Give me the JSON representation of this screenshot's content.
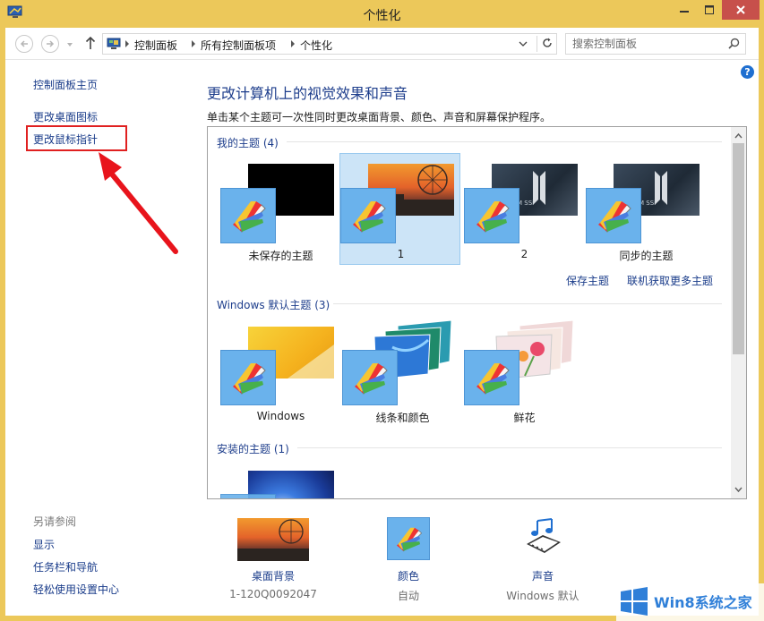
{
  "window": {
    "title": "个性化",
    "colors": {
      "frame": "#ecc85a",
      "close": "#c7504b",
      "link": "#1a3c8a",
      "heading": "#1e3e8c",
      "selection": "#cce4f7"
    }
  },
  "nav": {
    "breadcrumbs": [
      "控制面板",
      "所有控制面板项",
      "个性化"
    ],
    "search_placeholder": "搜索控制面板"
  },
  "left_pane": {
    "links": [
      "控制面板主页",
      "更改桌面图标",
      "更改鼠标指针"
    ],
    "see_also_title": "另请参阅",
    "see_also": [
      "显示",
      "任务栏和导航",
      "轻松使用设置中心"
    ]
  },
  "main": {
    "title": "更改计算机上的视觉效果和声音",
    "description": "单击某个主题可一次性同时更改桌面背景、颜色、声音和屏幕保护程序。"
  },
  "groups": {
    "my_themes": {
      "title": "我的主题 (4)",
      "themes": [
        {
          "label": "未保存的主题",
          "selected": false
        },
        {
          "label": "1",
          "selected": true
        },
        {
          "label": "2",
          "selected": false
        },
        {
          "label": "同步的主题",
          "selected": false
        }
      ],
      "save_link": "保存主题",
      "online_link": "联机获取更多主题"
    },
    "default_themes": {
      "title": "Windows 默认主题 (3)",
      "themes": [
        {
          "label": "Windows"
        },
        {
          "label": "线条和颜色"
        },
        {
          "label": "鲜花"
        }
      ]
    },
    "installed_themes": {
      "title": "安装的主题 (1)"
    }
  },
  "customize": {
    "background": {
      "label": "桌面背景",
      "value": "1-120Q0092047"
    },
    "color": {
      "label": "颜色",
      "value": "自动"
    },
    "sound": {
      "label": "声音",
      "value": "Windows 默认"
    }
  },
  "watermark": {
    "text": "Win8系统之家"
  }
}
